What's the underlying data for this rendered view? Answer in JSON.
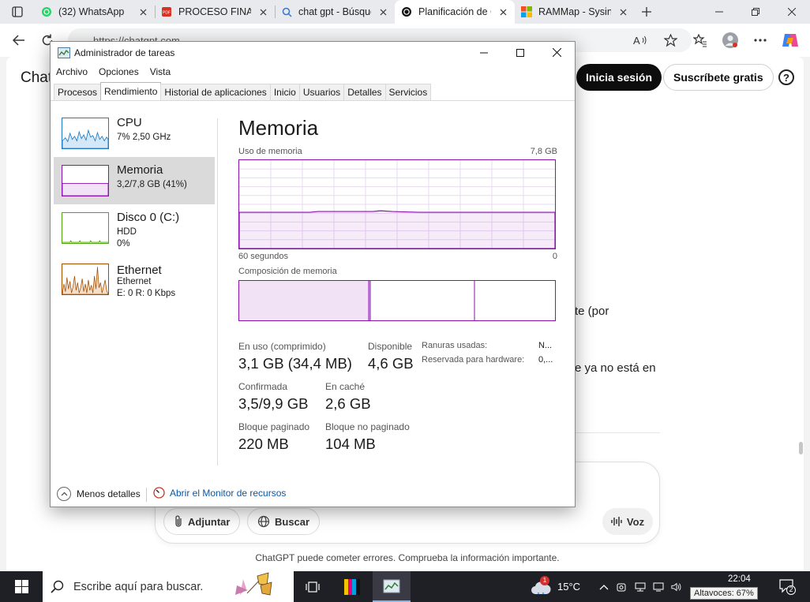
{
  "browser": {
    "tabs": [
      {
        "title": "(32) WhatsApp",
        "icon": "whatsapp-icon",
        "active": false
      },
      {
        "title": "PROCESO FINAL",
        "icon": "pdf-icon",
        "active": false
      },
      {
        "title": "chat gpt - Búsque",
        "icon": "search-icon",
        "active": false
      },
      {
        "title": "Planificación de C",
        "icon": "openai-icon",
        "active": true
      },
      {
        "title": "RAMMap - Sysint",
        "icon": "microsoft-icon",
        "active": false
      }
    ],
    "url": "https://chatgpt.com"
  },
  "chatgpt": {
    "brand": "Chat",
    "login": "Inicia sesión",
    "signup": "Suscríbete gratis",
    "help": "?",
    "text_frag_1": "te (por",
    "text_frag_2": "e ya no está en",
    "attach": "Adjuntar",
    "search": "Buscar",
    "voice": "Voz",
    "footnote": "ChatGPT puede cometer errores. Comprueba la información importante."
  },
  "taskmanager": {
    "title": "Administrador de tareas",
    "menu": [
      "Archivo",
      "Opciones",
      "Vista"
    ],
    "tabs": [
      "Procesos",
      "Rendimiento",
      "Historial de aplicaciones",
      "Inicio",
      "Usuarios",
      "Detalles",
      "Servicios"
    ],
    "active_tab": "Rendimiento",
    "resources": [
      {
        "name": "CPU",
        "sub1": "7% 2,50 GHz",
        "sub2": "",
        "sub3": "",
        "color": "#1c7bc4"
      },
      {
        "name": "Memoria",
        "sub1": "3,2/7,8 GB (41%)",
        "sub2": "",
        "sub3": "",
        "color": "#8b12ae"
      },
      {
        "name": "Disco 0 (C:)",
        "sub1": "HDD",
        "sub2": "0%",
        "sub3": "",
        "color": "#4da60c"
      },
      {
        "name": "Ethernet",
        "sub1": "Ethernet",
        "sub2": "E: 0 R: 0 Kbps",
        "sub3": "",
        "color": "#a74f01"
      }
    ],
    "memory": {
      "title": "Memoria",
      "usage_label": "Uso de memoria",
      "max_label": "7,8 GB",
      "time_left": "60 segundos",
      "time_right": "0",
      "composition_label": "Composición de memoria",
      "usage_fraction": 0.41,
      "composition": {
        "in_use_fraction": 0.41,
        "modified_fraction": 0.005,
        "standby_fraction": 0.33
      },
      "stats": {
        "in_use_label": "En uso (comprimido)",
        "in_use_value": "3,1 GB (34,4 MB)",
        "available_label": "Disponible",
        "available_value": "4,6 GB",
        "committed_label": "Confirmada",
        "committed_value": "3,5/9,9 GB",
        "cached_label": "En caché",
        "cached_value": "2,6 GB",
        "paged_label": "Bloque paginado",
        "paged_value": "220 MB",
        "nonpaged_label": "Bloque no paginado",
        "nonpaged_value": "104 MB"
      },
      "kv": [
        {
          "key": "Ranuras usadas:",
          "value": "N..."
        },
        {
          "key": "Reservada para hardware:",
          "value": "0,..."
        }
      ]
    },
    "footer": {
      "fewer_details": "Menos detalles",
      "resource_monitor": "Abrir el Monitor de recursos"
    }
  },
  "taskbar": {
    "search_placeholder": "Escribe aquí para buscar.",
    "temperature": "15°C",
    "weather_badge": "1",
    "time": "22:04",
    "volume_tooltip": "Altavoces: 67%",
    "notifications": "2"
  }
}
